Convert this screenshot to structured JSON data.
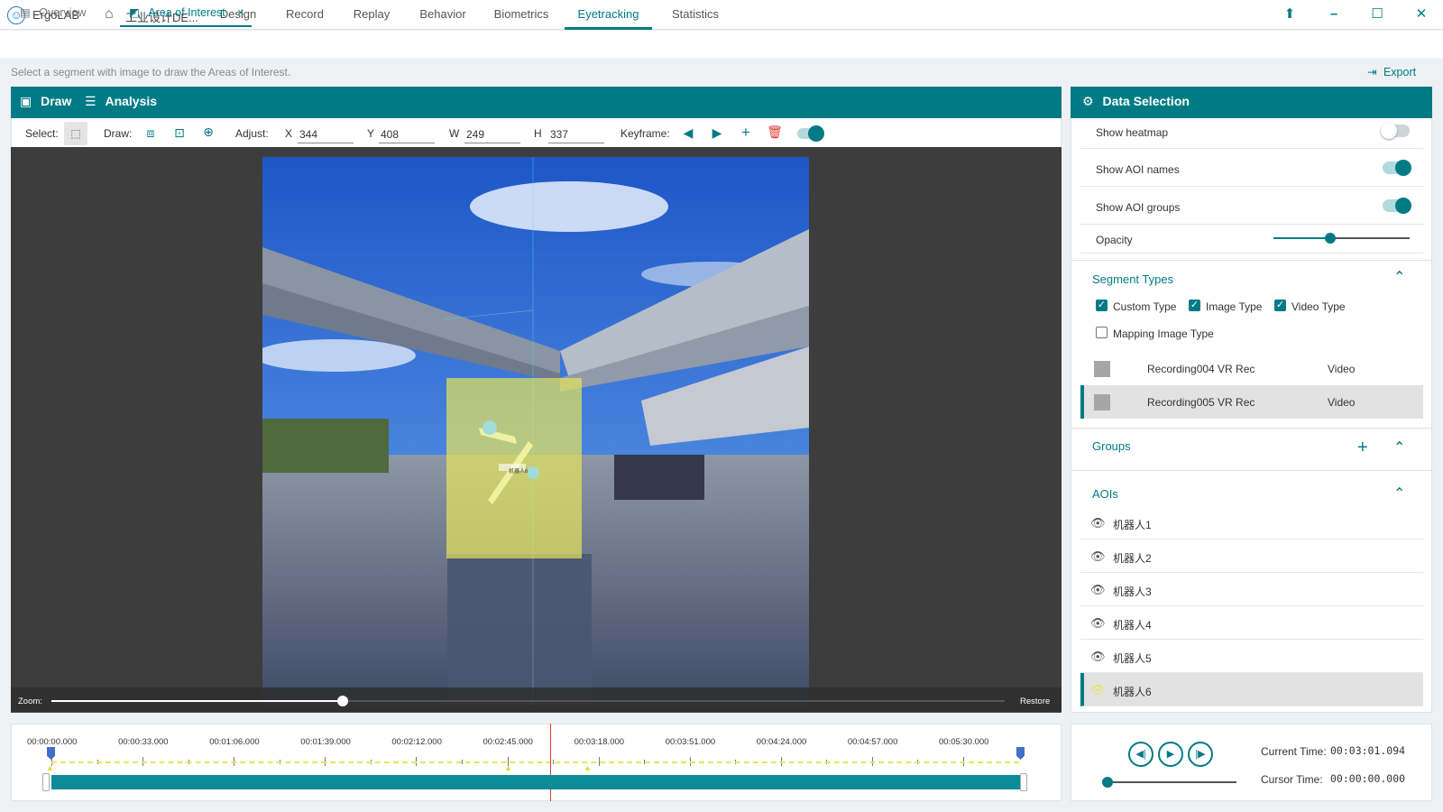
{
  "app": {
    "name": "ErgoLAB",
    "project": "工业设计DE..."
  },
  "menu": [
    {
      "label": "Design"
    },
    {
      "label": "Record"
    },
    {
      "label": "Replay"
    },
    {
      "label": "Behavior"
    },
    {
      "label": "Biometrics"
    },
    {
      "label": "Eyetracking",
      "active": true
    },
    {
      "label": "Statistics"
    }
  ],
  "tabs": {
    "overview": "Overview",
    "aoi": "Area of Interest",
    "close": "×"
  },
  "hint": "Select a segment with image to draw the Areas of Interest.",
  "export": "Export",
  "left_panel": {
    "draw": "Draw",
    "analysis": "Analysis"
  },
  "toolbar": {
    "select": "Select:",
    "draw": "Draw:",
    "adjust": "Adjust:",
    "keyframe": "Keyframe:",
    "x_label": "X",
    "x": "344",
    "y_label": "Y",
    "y": "408",
    "w_label": "W",
    "w": "249",
    "h_label": "H",
    "h": "337"
  },
  "viewer": {
    "zoom": "Zoom:",
    "restore": "Restore",
    "aoi_tag": "机器人6"
  },
  "data_selection": {
    "title": "Data Selection",
    "show_heatmap": "Show heatmap",
    "show_aoi_names": "Show AOI names",
    "show_aoi_groups": "Show AOI groups",
    "opacity": "Opacity",
    "opacity_level": 0.42,
    "segment_types": "Segment Types",
    "custom_type": "Custom Type",
    "image_type": "Image Type",
    "video_type": "Video Type",
    "mapping_image_type": "Mapping Image Type",
    "recordings": [
      {
        "name": "Recording004 VR Rec",
        "type": "Video"
      },
      {
        "name": "Recording005 VR Rec",
        "type": "Video"
      }
    ],
    "groups": "Groups",
    "aois_title": "AOIs",
    "aois": [
      "机器人1",
      "机器人2",
      "机器人3",
      "机器人4",
      "机器人5",
      "机器人6"
    ]
  },
  "timeline": {
    "ticks": [
      "00:00:00.000",
      "00:00:33.000",
      "00:01:06.000",
      "00:01:39.000",
      "00:02:12.000",
      "00:02:45.000",
      "00:03:18.000",
      "00:03:51.000",
      "00:04:24.000",
      "00:04:57.000",
      "00:05:30.000"
    ]
  },
  "playback": {
    "current_label": "Current Time:",
    "current": "00:03:01.094",
    "cursor_label": "Cursor Time:",
    "cursor": "00:00:00.000"
  },
  "colors": {
    "accent": "#007b85",
    "aoi_fill": "#e6e65a",
    "delete": "#e53935"
  }
}
